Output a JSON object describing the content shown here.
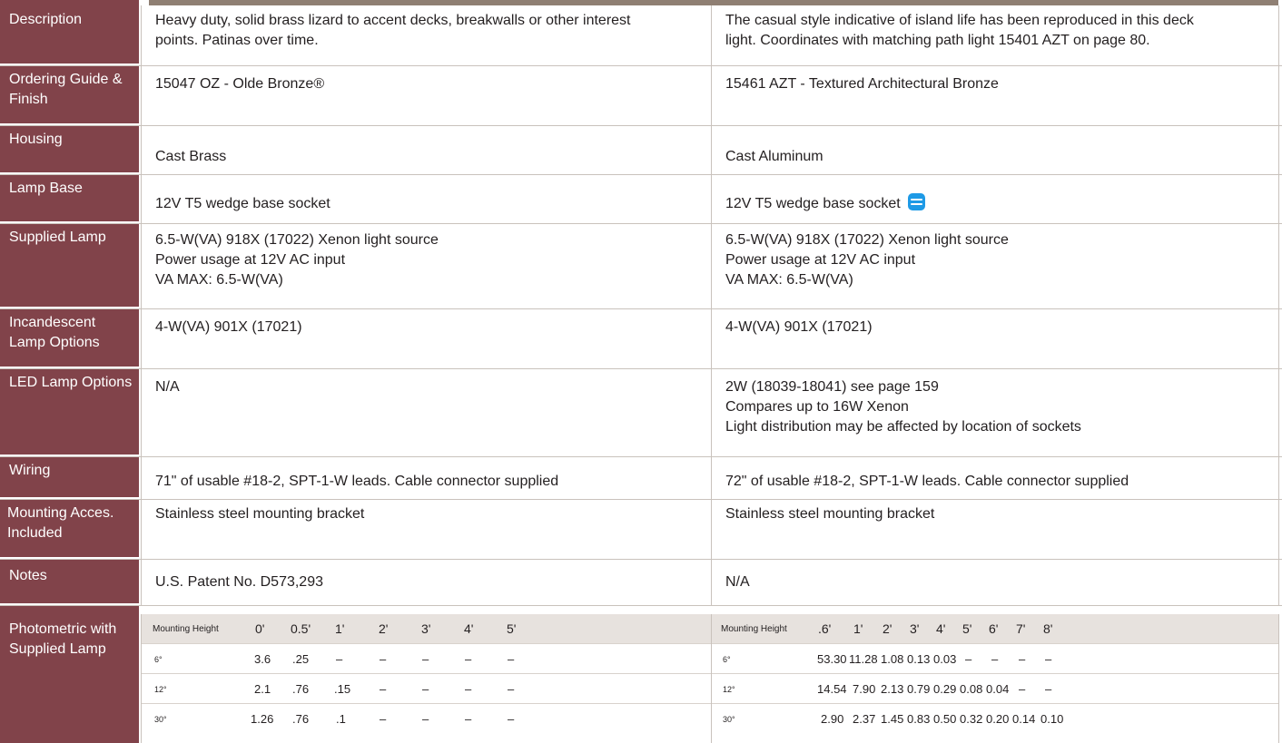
{
  "rows": [
    {
      "label": [
        "Description"
      ],
      "c1": [
        "Heavy duty, solid brass lizard to accent decks, breakwalls or other interest",
        "points. Patinas over time."
      ],
      "c2": [
        "The casual style indicative of island life has been reproduced in this deck",
        "light. Coordinates with matching path light 15401 AZT on page 80."
      ]
    },
    {
      "label": [
        "Ordering Guide",
        "& Finish"
      ],
      "c1": [
        "15047 OZ - Olde Bronze®"
      ],
      "c2": [
        "15461 AZT - Textured Architectural Bronze"
      ]
    },
    {
      "label": [
        "Housing"
      ],
      "c1": [
        "Cast Brass"
      ],
      "c2": [
        "Cast Aluminum"
      ]
    },
    {
      "label": [
        "Lamp Base"
      ],
      "c1": [
        "12V T5 wedge base socket"
      ],
      "c2": [
        "12V T5 wedge base socket"
      ]
    },
    {
      "label": [
        "Supplied Lamp"
      ],
      "c1": [
        "6.5-W(VA) 918X (17022) Xenon light source",
        "Power usage at 12V AC input",
        "VA MAX: 6.5-W(VA)"
      ],
      "c2": [
        "6.5-W(VA) 918X (17022) Xenon light source",
        "Power usage at 12V AC input",
        "VA MAX: 6.5-W(VA)"
      ]
    },
    {
      "label": [
        "Incandescent",
        "Lamp Options"
      ],
      "c1": [
        "4-W(VA) 901X (17021)"
      ],
      "c2": [
        "4-W(VA) 901X (17021)"
      ]
    },
    {
      "label": [
        "LED Lamp",
        "Options"
      ],
      "c1": [
        "N/A"
      ],
      "c2": [
        "2W (18039-18041) see page 159",
        "Compares up to 16W Xenon",
        "Light distribution may be affected by location of sockets"
      ]
    },
    {
      "label": [
        "Wiring"
      ],
      "c1": [
        "71\" of usable #18-2, SPT-1-W leads. Cable connector supplied"
      ],
      "c2": [
        "72\" of usable #18-2, SPT-1-W leads. Cable connector supplied"
      ]
    },
    {
      "label": [
        "Mounting Acces.",
        "Included"
      ],
      "c1": [
        "Stainless steel mounting bracket"
      ],
      "c2": [
        "Stainless steel mounting bracket"
      ]
    },
    {
      "label": [
        "Notes"
      ],
      "c1": [
        "U.S. Patent No. D573,293"
      ],
      "c2": [
        "N/A"
      ]
    }
  ],
  "photometric": {
    "label": [
      "Photometric",
      "with Supplied",
      "Lamp"
    ],
    "left": {
      "header_label": "Mounting Height",
      "heights": [
        "0'",
        "0.5'",
        "1'",
        "2'",
        "3'",
        "4'",
        "5'"
      ],
      "rows": [
        {
          "angle": "6°",
          "values": [
            "3.6",
            ".25",
            "–",
            "–",
            "–",
            "–",
            "–"
          ]
        },
        {
          "angle": "12°",
          "values": [
            "2.1",
            ".76",
            ".15",
            "–",
            "–",
            "–",
            "–"
          ]
        },
        {
          "angle": "30°",
          "values": [
            "1.26",
            ".76",
            ".1",
            "–",
            "–",
            "–",
            "–"
          ]
        }
      ]
    },
    "right": {
      "header_label": "Mounting Height",
      "heights": [
        ".6'",
        "1'",
        "2'",
        "3'",
        "4'",
        "5'",
        "6'",
        "7'",
        "8'"
      ],
      "rows": [
        {
          "angle": "6°",
          "values": [
            "53.30",
            "11.28",
            "1.08",
            "0.13",
            "0.03",
            "–",
            "–",
            "–",
            "–"
          ]
        },
        {
          "angle": "12°",
          "values": [
            "14.54",
            "7.90",
            "2.13",
            "0.79",
            "0.29",
            "0.08",
            "0.04",
            "–",
            "–"
          ]
        },
        {
          "angle": "30°",
          "values": [
            "2.90",
            "2.37",
            "1.45",
            "0.83",
            "0.50",
            "0.32",
            "0.20",
            "0.14",
            "0.10"
          ]
        }
      ]
    }
  },
  "colors": {
    "label_bg": "#81434a",
    "header_bg": "#e7e2de",
    "accent": "#1e9ae6"
  }
}
